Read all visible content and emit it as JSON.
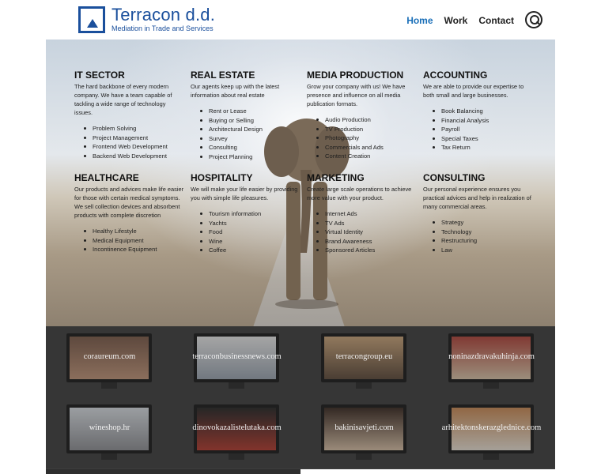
{
  "brand": {
    "title": "Terracon d.d.",
    "subtitle": "Mediation in Trade and Services",
    "color": "#1a4f9c"
  },
  "nav": {
    "home": "Home",
    "work": "Work",
    "contact": "Contact",
    "active_color": "#1a6fb8"
  },
  "sectors": [
    {
      "title": "IT SECTOR",
      "text": "The hard backbone of every modern company. We have a team capable of tackling a wide range of technology issues.",
      "items": [
        "Problem Solving",
        "Project Management",
        "Frontend Web Development",
        "Backend Web Development"
      ]
    },
    {
      "title": "REAL ESTATE",
      "text": "Our agents keep up with the latest information about real estate",
      "items": [
        "Rent or Lease",
        "Buying or Selling",
        "Architectural Design",
        "Survey",
        "Consulting",
        "Project Planning"
      ]
    },
    {
      "title": "MEDIA PRODUCTION",
      "text": "Grow your company with us! We have presence and influence on all media publication formats.",
      "items": [
        "Audio Production",
        "TV Production",
        "Photography",
        "Commercials and Ads",
        "Content Creation"
      ]
    },
    {
      "title": "ACCOUNTING",
      "text": "We are able to provide our expertise to both small and large businesses.",
      "items": [
        "Book Balancing",
        "Financial Analysis",
        "Payroll",
        "Special Taxes",
        "Tax Return"
      ]
    },
    {
      "title": "HEALTHCARE",
      "text": "Our products and advices make life easier for those with certain medical symptoms. We sell collection devices and absorbent products with complete discretion",
      "items": [
        "Healthy Lifestyle",
        "Medical Equipment",
        "Incontinence Equipment"
      ]
    },
    {
      "title": "HOSPITALITY",
      "text": "We will make your life easier by providing you with simple life pleasures.",
      "items": [
        "Tourism information",
        "Yachts",
        "Food",
        "Wine",
        "Coffee"
      ]
    },
    {
      "title": "MARKETING",
      "text": "Create large scale operations to achieve more value with your product.",
      "items": [
        "Internet Ads",
        "TV Ads",
        "Virtual Identity",
        "Brand Awareness",
        "Sponsored Articles"
      ]
    },
    {
      "title": "CONSULTING",
      "text": "Our personal experience ensures you practical advices and help in realization of many commercial areas.",
      "items": [
        "Strategy",
        "Technology",
        "Restructuring",
        "Law"
      ]
    }
  ],
  "portfolio": [
    "coraureum.com",
    "terraconbusinessnews.com",
    "terracongroup.eu",
    "noninazdravakuhinja.com",
    "wineshop.hr",
    "dinovokazalistelutaka.com",
    "bakinisavjeti.com",
    "arhitektonskerazglednice.com"
  ]
}
